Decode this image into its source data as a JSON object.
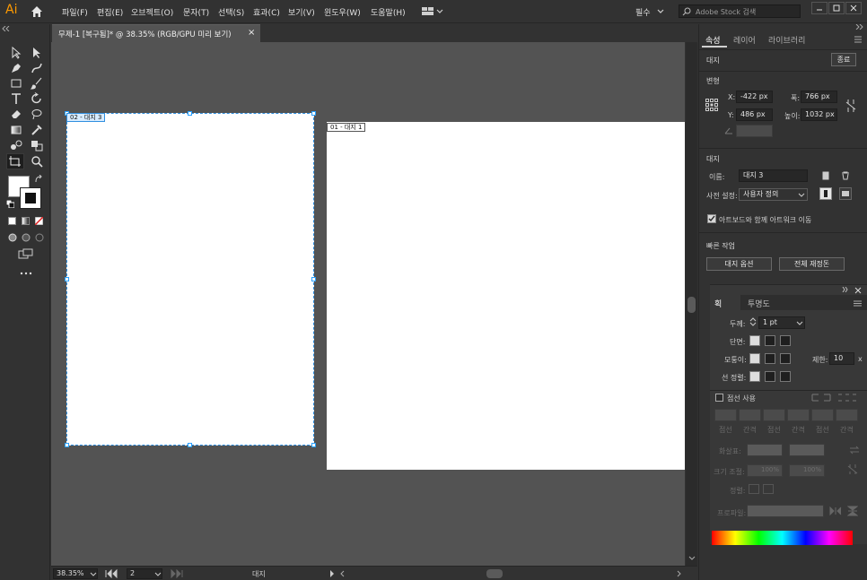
{
  "app": {
    "logo": "Ai"
  },
  "menu": [
    "파일(F)",
    "편집(E)",
    "오브젝트(O)",
    "문자(T)",
    "선택(S)",
    "효과(C)",
    "보기(V)",
    "윈도우(W)",
    "도움말(H)"
  ],
  "workspace": {
    "label": "필수"
  },
  "search": {
    "placeholder": "Adobe Stock 검색"
  },
  "document_tab": {
    "title": "무제-1 [복구됨]* @ 38.35% (RGB/GPU 미리 보기)",
    "close": "×"
  },
  "artboards": [
    {
      "label": "02 - 대지 3"
    },
    {
      "label": "01 - 대지 1"
    }
  ],
  "status": {
    "zoom": "38.35%",
    "artboard_number": "2",
    "tool_name": "대지"
  },
  "panel_tabs": [
    "속성",
    "레이어",
    "라이브러리"
  ],
  "properties": {
    "context_label": "대지",
    "finish_button": "종료",
    "transform_title": "변형",
    "x_label": "X:",
    "x_value": "-422 px",
    "y_label": "Y:",
    "y_value": "486 px",
    "w_label": "폭:",
    "w_value": "766 px",
    "h_label": "높이:",
    "h_value": "1032 px",
    "artboard_title": "대지",
    "name_label": "이름:",
    "name_value": "대지 3",
    "preset_label": "사전 설정:",
    "preset_value": "사용자 정의",
    "move_with_artwork": "아트보드와 함께 아트워크 이동",
    "quick_actions_title": "빠른 작업",
    "artboard_options_button": "대지 옵션",
    "rearrange_all_button": "전체 재정돈"
  },
  "stroke_panel": {
    "tabs": [
      "획",
      "투명도"
    ],
    "weight_label": "두께:",
    "weight_value": "1 pt",
    "cap_label": "단면:",
    "corner_label": "모퉁이:",
    "limit_label": "제한:",
    "limit_value": "10",
    "limit_unit": "x",
    "align_label": "선 정렬:",
    "dashed_label": "점선 사용",
    "dash_labels": [
      "점선",
      "간격",
      "점선",
      "간격",
      "점선",
      "간격"
    ],
    "arrow_label": "화살표:",
    "scale_label": "크기 조절:",
    "scale_value_1": "100%",
    "scale_value_2": "100%",
    "align_arrow_label": "정렬:",
    "profile_label": "프로파일:"
  }
}
